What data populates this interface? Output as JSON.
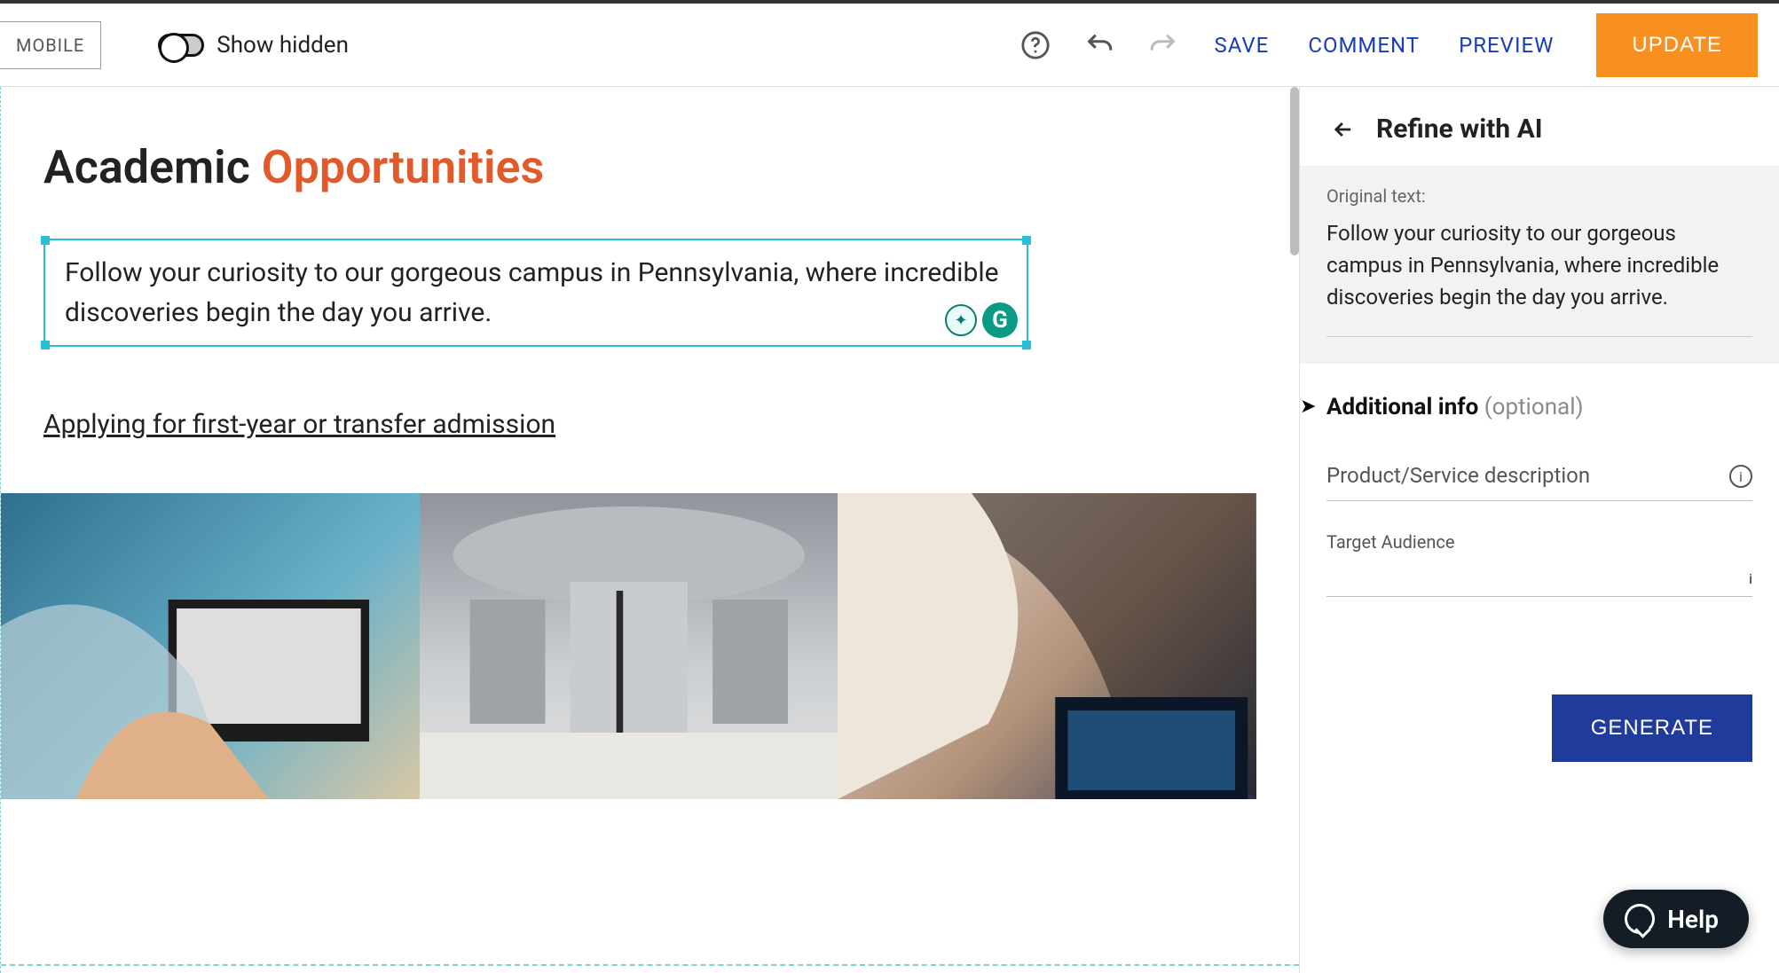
{
  "toolbar": {
    "mobile_label": "MOBILE",
    "show_hidden_label": "Show hidden",
    "save": "SAVE",
    "comment": "COMMENT",
    "preview": "PREVIEW",
    "update": "UPDATE"
  },
  "page": {
    "title_part1": "Academic ",
    "title_part2": "Opportunities",
    "selected_paragraph": "Follow your curiosity to our gorgeous campus in Pennsylvania, where incredible discoveries begin the day you arrive.",
    "apply_link": "Applying for first-year or transfer admission"
  },
  "panel": {
    "title": "Refine with AI",
    "original_label": "Original text:",
    "original_text": "Follow your curiosity to our gorgeous campus in Pennsylvania, where incredible discoveries begin the day you arrive.",
    "additional_label": "Additional info ",
    "additional_optional": "(optional)",
    "product_placeholder": "Product/Service description",
    "audience_label": "Target Audience",
    "generate": "GENERATE"
  },
  "help": {
    "label": "Help"
  },
  "icons": {
    "help_circle": "help-circle-icon",
    "undo": "undo-icon",
    "redo": "redo-icon",
    "back": "arrow-left-icon",
    "info": "info-icon",
    "chat": "chat-bubble-icon",
    "grammarly_suggest": "lightbulb-icon",
    "grammarly_main": "grammarly-icon"
  }
}
